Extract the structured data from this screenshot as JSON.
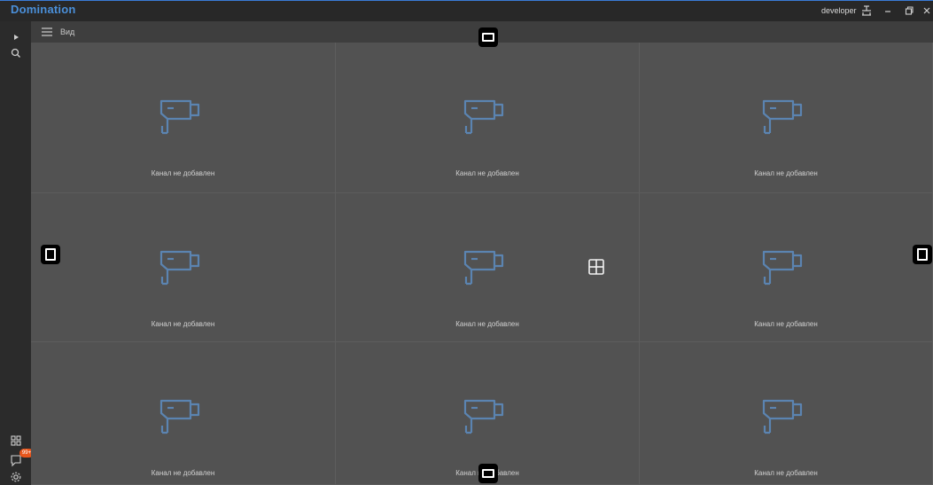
{
  "window": {
    "app_name": "Domination",
    "user": "developer",
    "colors": {
      "accent": "#4a8fd9",
      "titlebar": "#282828",
      "badge": "#e8561c",
      "camera_icon": "#5b84b1"
    }
  },
  "sidebar": {
    "notifications_badge": "99+"
  },
  "toolbar": {
    "view_label": "Вид"
  },
  "grid": {
    "rows": 3,
    "columns": 3,
    "cells": [
      {
        "label": "Канал не добавлен"
      },
      {
        "label": "Канал не добавлен"
      },
      {
        "label": "Канал не добавлен"
      },
      {
        "label": "Канал не добавлен"
      },
      {
        "label": "Канал не добавлен"
      },
      {
        "label": "Канал не добавлен"
      },
      {
        "label": "Канал не добавлен"
      },
      {
        "label": "Канал не добавлен"
      },
      {
        "label": "Канал не добавлен"
      }
    ]
  }
}
